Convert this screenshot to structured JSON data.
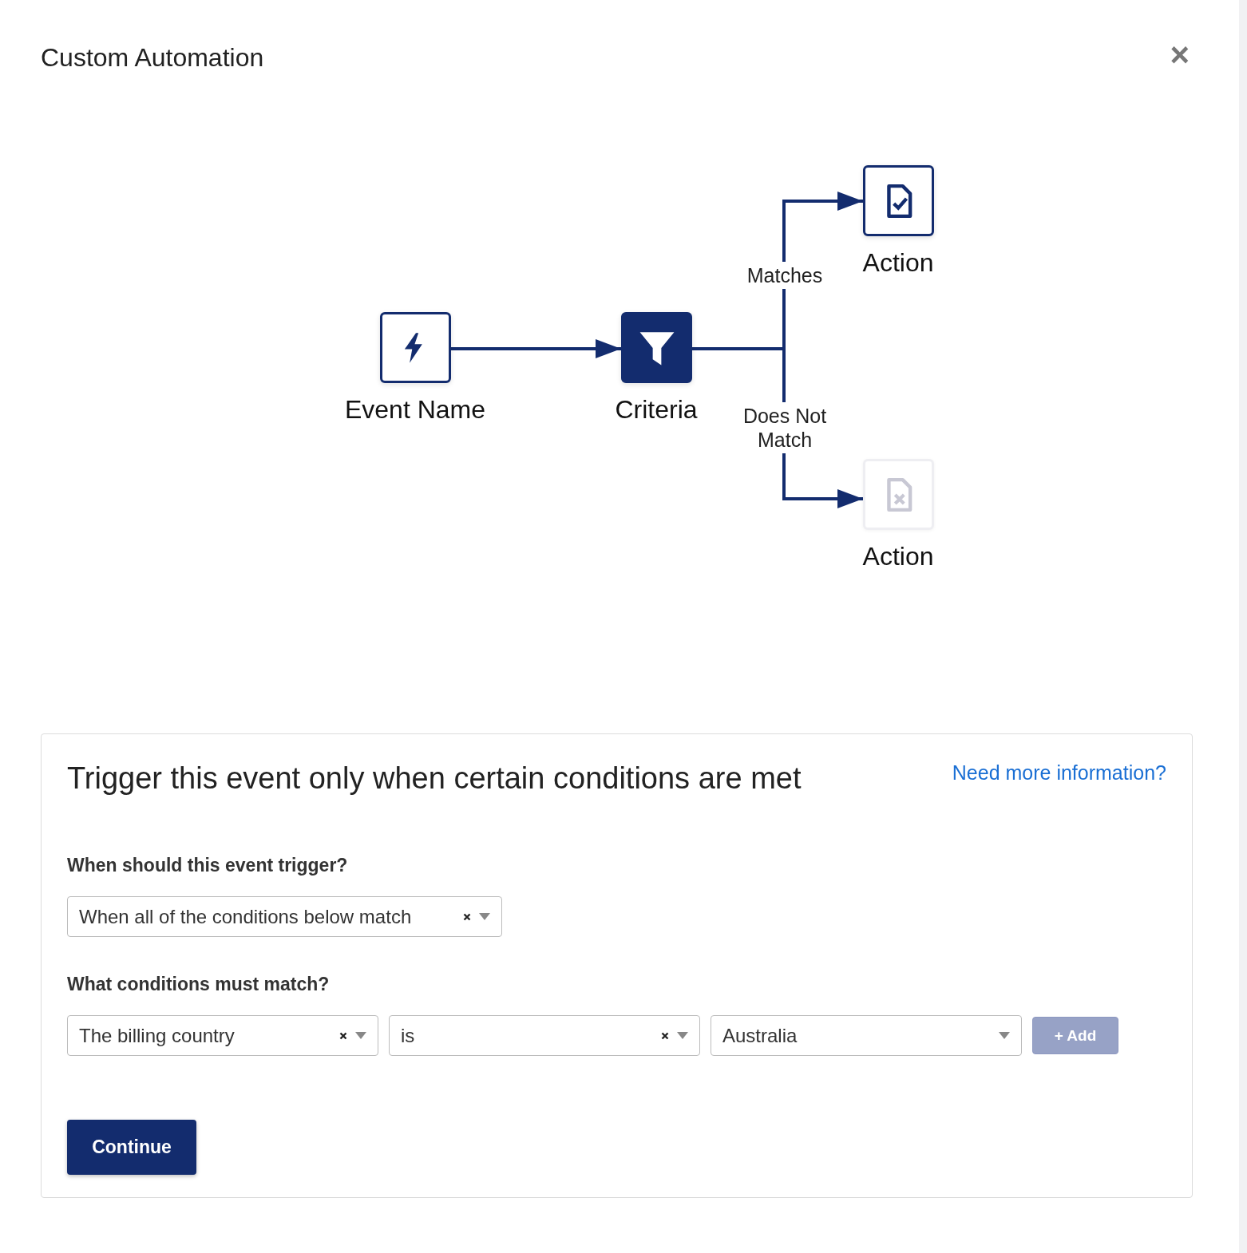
{
  "window": {
    "title": "Custom Automation",
    "close_label": "×"
  },
  "diagram": {
    "nodes": [
      {
        "kind": "event",
        "label": "Event Name",
        "disabled": false
      },
      {
        "kind": "criteria",
        "label": "Criteria",
        "disabled": false
      },
      {
        "kind": "action-match",
        "label": "Action",
        "disabled": false
      },
      {
        "kind": "action-nomatch",
        "label": "Action",
        "disabled": true
      }
    ],
    "branches": [
      {
        "kind": "match",
        "label": "Matches"
      },
      {
        "kind": "nomatch",
        "label": "Does Not Match"
      }
    ]
  },
  "conditions_card": {
    "title": "Trigger this event only when certain conditions are met",
    "help_link": "Need more information?",
    "trigger_question": "When should this event trigger?",
    "trigger_select": {
      "value": "When all of the conditions below match",
      "clearable": true
    },
    "conditions_question": "What conditions must match?",
    "condition_row": [
      {
        "value": "The billing country",
        "clearable": true
      },
      {
        "value": "is",
        "clearable": true
      },
      {
        "value": "Australia",
        "clearable": false
      }
    ],
    "add_button": {
      "label": "+ Add",
      "disabled": true
    },
    "continue_button": {
      "label": "Continue"
    }
  }
}
